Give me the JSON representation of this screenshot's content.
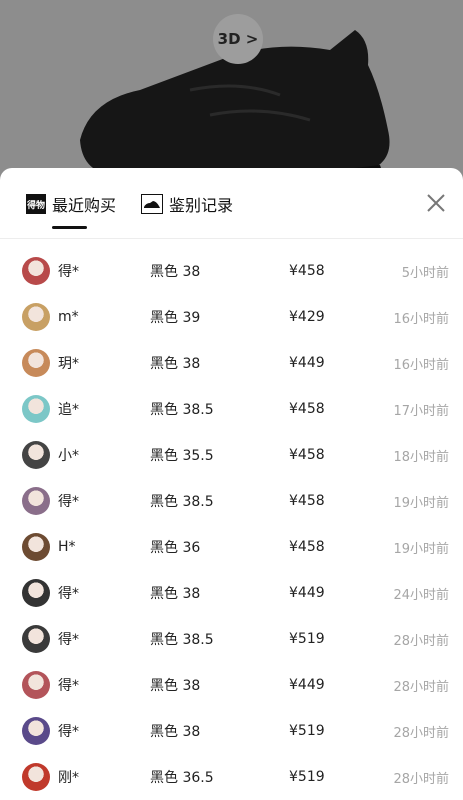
{
  "header": {
    "btn3d": "3D >"
  },
  "tabs": [
    {
      "label": "最近购买",
      "logo": "得物"
    },
    {
      "label": "鉴别记录"
    }
  ],
  "icons": {
    "close": "close-icon",
    "shoe": "shoe-icon"
  },
  "colors": {
    "accent": "#111111",
    "muted": "#a6a6a6"
  },
  "purchases": [
    {
      "name": "得*",
      "spec": "黑色 38",
      "price": "¥458",
      "time": "5小时前",
      "avatar_color": "#b84a4a"
    },
    {
      "name": "m*",
      "spec": "黑色 39",
      "price": "¥429",
      "time": "16小时前",
      "avatar_color": "#c8a064"
    },
    {
      "name": "玥*",
      "spec": "黑色 38",
      "price": "¥449",
      "time": "16小时前",
      "avatar_color": "#c78a5a"
    },
    {
      "name": "追*",
      "spec": "黑色 38.5",
      "price": "¥458",
      "time": "17小时前",
      "avatar_color": "#7cc7c7"
    },
    {
      "name": "小*",
      "spec": "黑色 35.5",
      "price": "¥458",
      "time": "18小时前",
      "avatar_color": "#444444"
    },
    {
      "name": "得*",
      "spec": "黑色 38.5",
      "price": "¥458",
      "time": "19小时前",
      "avatar_color": "#8a6e8a"
    },
    {
      "name": "H*",
      "spec": "黑色 36",
      "price": "¥458",
      "time": "19小时前",
      "avatar_color": "#6d4b32"
    },
    {
      "name": "得*",
      "spec": "黑色 38",
      "price": "¥449",
      "time": "24小时前",
      "avatar_color": "#333333"
    },
    {
      "name": "得*",
      "spec": "黑色 38.5",
      "price": "¥519",
      "time": "28小时前",
      "avatar_color": "#3a3a3a"
    },
    {
      "name": "得*",
      "spec": "黑色 38",
      "price": "¥449",
      "time": "28小时前",
      "avatar_color": "#b3545a"
    },
    {
      "name": "得*",
      "spec": "黑色 38",
      "price": "¥519",
      "time": "28小时前",
      "avatar_color": "#5a4a8a"
    },
    {
      "name": "刚*",
      "spec": "黑色 36.5",
      "price": "¥519",
      "time": "28小时前",
      "avatar_color": "#c0392b"
    }
  ]
}
